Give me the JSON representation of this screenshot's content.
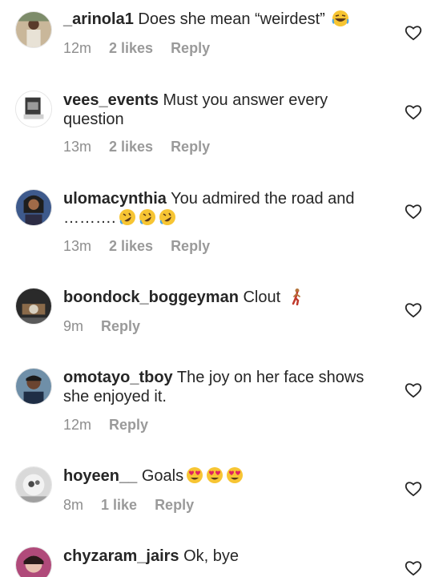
{
  "comments": [
    {
      "username": "_arinola1",
      "text": " Does she mean “weirdest” ",
      "emojis": [
        "laughing"
      ],
      "time": "12m",
      "likes": "2 likes",
      "reply": "Reply"
    },
    {
      "username": "vees_events",
      "text": " Must you answer every question",
      "emojis": [],
      "time": "13m",
      "likes": "2 likes",
      "reply": "Reply"
    },
    {
      "username": "ulomacynthia",
      "text": " You admired the road and ……….",
      "emojis": [
        "rofl",
        "rofl",
        "rofl"
      ],
      "time": "13m",
      "likes": "2 likes",
      "reply": "Reply"
    },
    {
      "username": "boondock_boggeyman",
      "text": " Clout ",
      "emojis": [
        "walking-person"
      ],
      "time": "9m",
      "likes": "",
      "reply": "Reply"
    },
    {
      "username": "omotayo_tboy",
      "text": " The joy on her face shows she enjoyed it.",
      "emojis": [],
      "time": "12m",
      "likes": "",
      "reply": "Reply"
    },
    {
      "username": "hoyeen__",
      "text": " Goals",
      "emojis": [
        "heart-eyes",
        "heart-eyes",
        "heart-eyes"
      ],
      "time": "8m",
      "likes": "1 like",
      "reply": "Reply"
    },
    {
      "username": "chyzaram_jairs",
      "text": " Ok, bye",
      "emojis": [],
      "time": "",
      "likes": "",
      "reply": ""
    }
  ],
  "colors": {
    "text": "#262626",
    "meta": "#8e8e8e",
    "heart_outline": "#262626",
    "emoji_face": "#f7c533"
  }
}
